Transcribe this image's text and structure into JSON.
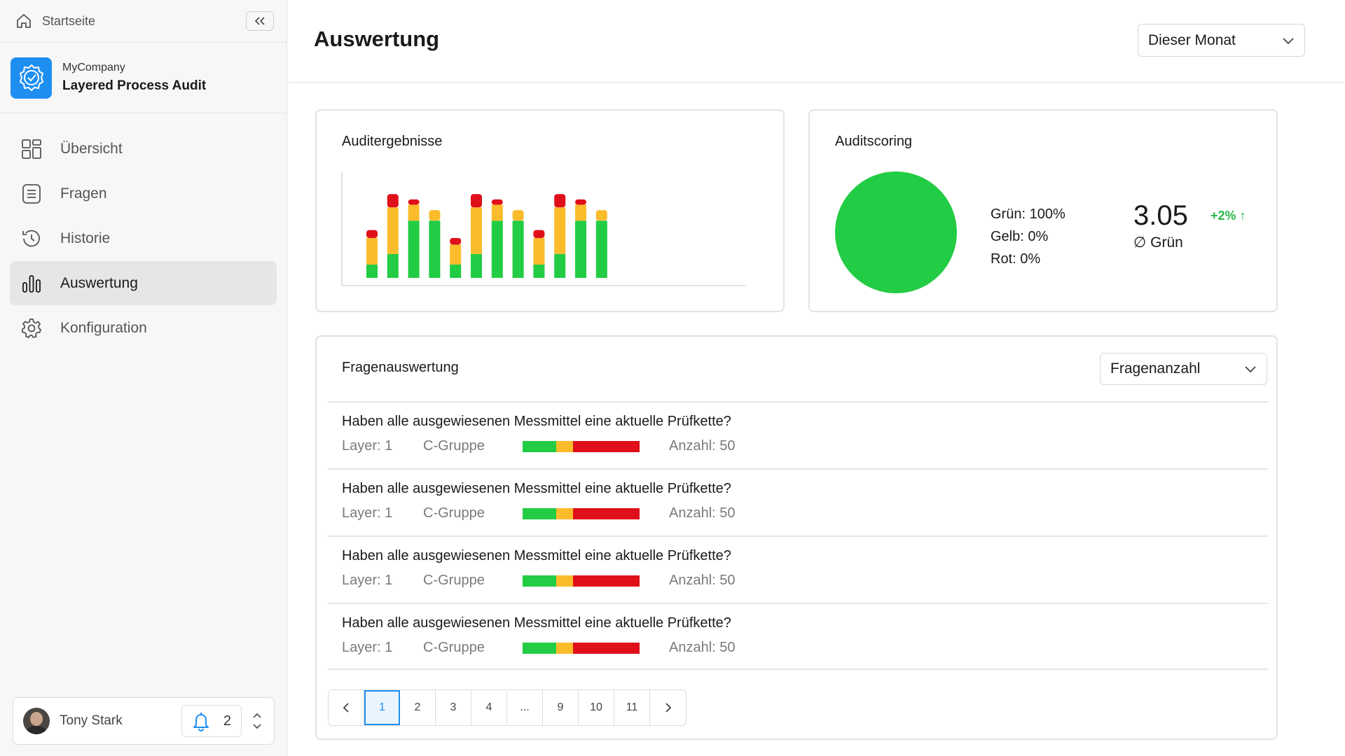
{
  "sidebar": {
    "home_label": "Startseite",
    "brand": {
      "company": "MyCompany",
      "product": "Layered Process Audit"
    },
    "nav": [
      {
        "label": "Übersicht",
        "icon": "grid-icon",
        "active": false
      },
      {
        "label": "Fragen",
        "icon": "list-icon",
        "active": false
      },
      {
        "label": "Historie",
        "icon": "history-icon",
        "active": false
      },
      {
        "label": "Auswertung",
        "icon": "bar-chart-icon",
        "active": true
      },
      {
        "label": "Konfiguration",
        "icon": "gear-icon",
        "active": false
      }
    ],
    "user": {
      "name": "Tony Stark",
      "notification_count": "2"
    }
  },
  "header": {
    "title": "Auswertung",
    "period_select": "Dieser Monat"
  },
  "colors": {
    "green": "#22cc44",
    "yellow": "#fbbc2c",
    "red": "#e0101a",
    "accent": "#1e8ff0"
  },
  "results_card": {
    "title": "Auditergebnisse",
    "chart_data": {
      "type": "bar",
      "stacked": true,
      "title": "Auditergebnisse",
      "categories": [
        "",
        "",
        "",
        "",
        "",
        "",
        "",
        "",
        "",
        "",
        "",
        ""
      ],
      "series": [
        {
          "color": "#22cc44",
          "values": [
            1.0,
            1.8,
            4.3,
            4.3,
            1.0,
            1.8,
            4.3,
            4.3,
            1.0,
            1.8,
            4.3,
            4.3
          ]
        },
        {
          "color": "#fbbc2c",
          "values": [
            2.0,
            3.5,
            1.2,
            0.8,
            1.5,
            3.5,
            1.2,
            0.8,
            2.0,
            3.5,
            1.2,
            0.8
          ]
        },
        {
          "color": "#e0101a",
          "values": [
            0.6,
            1.0,
            0.4,
            0.0,
            0.5,
            1.0,
            0.4,
            0.0,
            0.6,
            1.0,
            0.4,
            0.0
          ]
        }
      ],
      "ylim": [
        0,
        8
      ],
      "grid": false,
      "xlabel": "",
      "ylabel": ""
    }
  },
  "scoring_card": {
    "title": "Auditscoring",
    "pie": {
      "Grün": 100,
      "Gelb": 0,
      "Rot": 0
    },
    "legend": {
      "green": "Grün: 100%",
      "yellow": "Gelb: 0%",
      "red": "Rot: 0%"
    },
    "score": "3.05",
    "delta": "+2% ↑",
    "score_label": "∅ Grün"
  },
  "questions_card": {
    "title": "Fragenauswertung",
    "select": "Fragenanzahl",
    "rows": [
      {
        "text": "Haben alle ausgewiesenen Messmittel eine aktuelle Prüfkette?",
        "layer": "Layer: 1",
        "group": "C-Gruppe",
        "count": "Anzahl: 50",
        "share": {
          "green": 0.29,
          "yellow": 0.14,
          "red": 0.57
        }
      },
      {
        "text": "Haben alle ausgewiesenen Messmittel eine aktuelle Prüfkette?",
        "layer": "Layer: 1",
        "group": "C-Gruppe",
        "count": "Anzahl: 50",
        "share": {
          "green": 0.29,
          "yellow": 0.14,
          "red": 0.57
        }
      },
      {
        "text": "Haben alle ausgewiesenen Messmittel eine aktuelle Prüfkette?",
        "layer": "Layer: 1",
        "group": "C-Gruppe",
        "count": "Anzahl: 50",
        "share": {
          "green": 0.29,
          "yellow": 0.14,
          "red": 0.57
        }
      },
      {
        "text": "Haben alle ausgewiesenen Messmittel eine aktuelle Prüfkette?",
        "layer": "Layer: 1",
        "group": "C-Gruppe",
        "count": "Anzahl: 50",
        "share": {
          "green": 0.29,
          "yellow": 0.14,
          "red": 0.57
        }
      }
    ],
    "pagination": {
      "pages": [
        "1",
        "2",
        "3",
        "4",
        "...",
        "9",
        "10",
        "11"
      ],
      "current": "1"
    }
  }
}
